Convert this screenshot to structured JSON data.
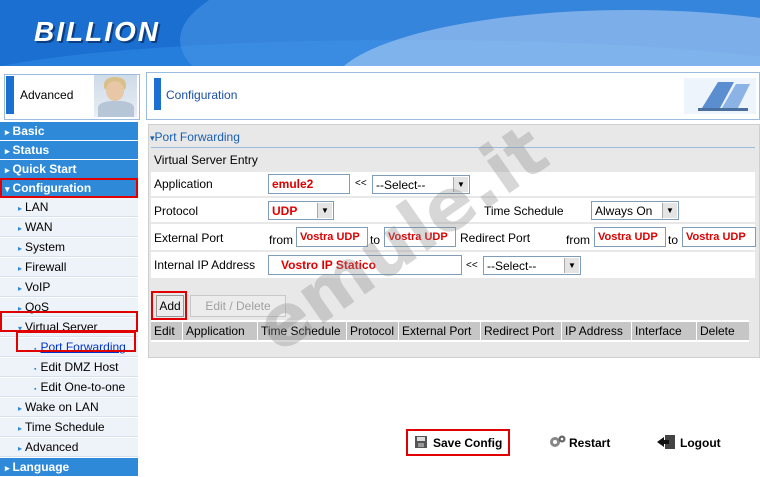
{
  "brand": {
    "logo_text": "BILLION"
  },
  "panel_label": "Advanced",
  "nav": {
    "main1": [
      {
        "label": "Basic"
      },
      {
        "label": "Status"
      },
      {
        "label": "Quick Start"
      },
      {
        "label": "Configuration"
      }
    ],
    "config_sub": [
      {
        "label": "LAN"
      },
      {
        "label": "WAN"
      },
      {
        "label": "System"
      },
      {
        "label": "Firewall"
      },
      {
        "label": "VoIP"
      },
      {
        "label": "QoS"
      },
      {
        "label": "Virtual Server"
      }
    ],
    "vs_sub": [
      {
        "label": "Port Forwarding"
      },
      {
        "label": "Edit DMZ Host"
      },
      {
        "label": "Edit One-to-one"
      }
    ],
    "config_sub2": [
      {
        "label": "Wake on LAN"
      },
      {
        "label": "Time Schedule"
      },
      {
        "label": "Advanced"
      }
    ],
    "main2": [
      {
        "label": "Language"
      }
    ]
  },
  "config_title": "Configuration",
  "section": {
    "title": "Port Forwarding",
    "subtitle": "Virtual Server Entry"
  },
  "form": {
    "application_label": "Application",
    "application_value": "emule2",
    "application_select": "--Select--",
    "protocol_label": "Protocol",
    "protocol_value": "UDP",
    "time_schedule_label": "Time Schedule",
    "time_schedule_value": "Always On",
    "external_port_label": "External Port",
    "from_label": "from",
    "to_label": "to",
    "external_from": "Vostra UDP",
    "external_to": "Vostra UDP",
    "redirect_port_label": "Redirect Port",
    "redirect_from": "Vostra UDP",
    "redirect_to": "Vostra UDP",
    "internal_ip_label": "Internal IP Address",
    "internal_ip_value": "Vostro IP Statico",
    "internal_ip_select": "--Select--",
    "arrow_text": "<<"
  },
  "buttons": {
    "add": "Add",
    "edit_delete": "Edit / Delete"
  },
  "table": {
    "columns": [
      "Edit",
      "Application",
      "Time Schedule",
      "Protocol",
      "External Port",
      "Redirect Port",
      "IP Address",
      "Interface",
      "Delete"
    ]
  },
  "actions": {
    "save": "Save Config",
    "restart": "Restart",
    "logout": "Logout"
  },
  "watermark": "emule.it",
  "colors": {
    "accent": "#1a6fd0",
    "highlight": "#e00000"
  }
}
